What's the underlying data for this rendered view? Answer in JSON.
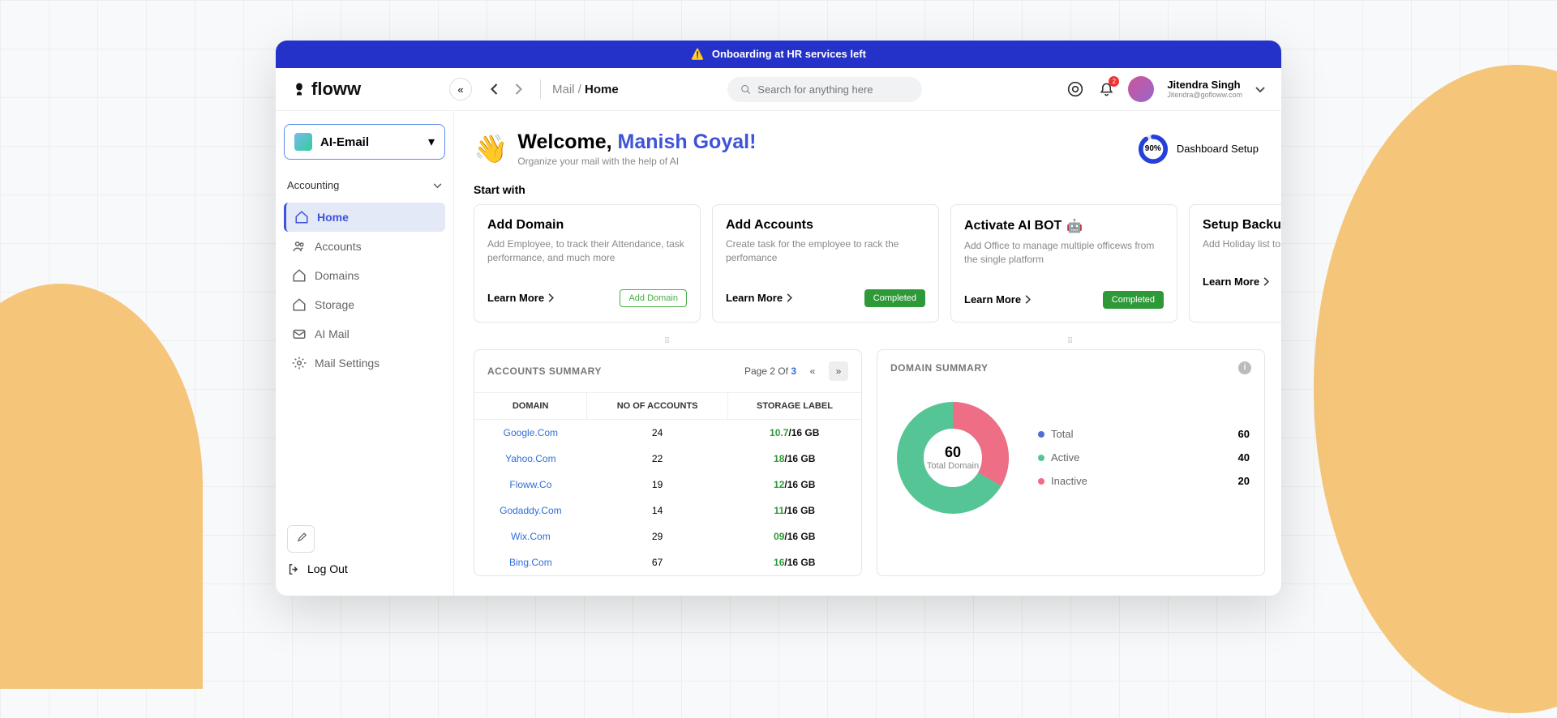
{
  "banner": {
    "text": "Onboarding at HR services left"
  },
  "brand": {
    "name": "floww"
  },
  "breadcrumb": {
    "section": "Mail",
    "current": "Home"
  },
  "search": {
    "placeholder": "Search for anything here"
  },
  "notifications": {
    "count": "2"
  },
  "user": {
    "name": "Jitendra Singh",
    "email": "Jitendra@gofloww.com"
  },
  "sidebar": {
    "app_selector": {
      "label": "AI-Email"
    },
    "section_label": "Accounting",
    "items": [
      {
        "icon": "home-icon",
        "label": "Home",
        "active": true
      },
      {
        "icon": "accounts-icon",
        "label": "Accounts"
      },
      {
        "icon": "domains-icon",
        "label": "Domains"
      },
      {
        "icon": "storage-icon",
        "label": "Storage"
      },
      {
        "icon": "aimail-icon",
        "label": "AI Mail"
      },
      {
        "icon": "settings-icon",
        "label": "Mail Settings"
      }
    ],
    "logout_label": "Log Out"
  },
  "welcome": {
    "greet": "Welcome, ",
    "name": "Manish Goyal!",
    "subtitle": "Organize your mail with the help of AI"
  },
  "setup": {
    "percent_label": "90%",
    "percent_value": 90,
    "text": "Dashboard Setup"
  },
  "start_with": "Start with",
  "cards": [
    {
      "title": "Add Domain",
      "desc": "Add Employee, to track their Attendance, task performance, and much more",
      "learn": "Learn More",
      "action": {
        "type": "button",
        "label": "Add  Domain"
      }
    },
    {
      "title": "Add Accounts",
      "desc": "Create task for the employee to rack the perfomance",
      "learn": "Learn More",
      "action": {
        "type": "status",
        "label": "Completed"
      }
    },
    {
      "title": "Activate AI BOT",
      "desc": "Add Office to manage multiple officews from the single platform",
      "learn": "Learn More",
      "robot": true,
      "action": {
        "type": "status",
        "label": "Completed"
      }
    },
    {
      "title": "Setup Backup",
      "desc": "Add Holiday list to m",
      "learn": "Learn More"
    }
  ],
  "accounts_panel": {
    "title": "ACCOUNTS SUMMARY",
    "pager": {
      "prefix": "Page 2 Of ",
      "total": "3"
    },
    "columns": [
      "DOMAIN",
      "NO OF ACCOUNTS",
      "STORAGE LABEL"
    ],
    "rows": [
      {
        "domain": "Google.Com",
        "accounts": "24",
        "used": "10.7",
        "total": "/16 GB"
      },
      {
        "domain": "Yahoo.Com",
        "accounts": "22",
        "used": "18",
        "total": "/16 GB"
      },
      {
        "domain": "Floww.Co",
        "accounts": "19",
        "used": "12",
        "total": "/16 GB"
      },
      {
        "domain": "Godaddy.Com",
        "accounts": "14",
        "used": "11",
        "total": "/16 GB"
      },
      {
        "domain": "Wix.Com",
        "accounts": "29",
        "used": "09",
        "total": "/16 GB"
      },
      {
        "domain": "Bing.Com",
        "accounts": "67",
        "used": "16",
        "total": "/16 GB"
      }
    ]
  },
  "domain_panel": {
    "title": "DOMAIN SUMMARY",
    "center": {
      "value": "60",
      "label": "Total Domain"
    },
    "legend": [
      {
        "label": "Total",
        "value": "60",
        "color": "#4f6ed4"
      },
      {
        "label": "Active",
        "value": "40",
        "color": "#56c596"
      },
      {
        "label": "Inactive",
        "value": "20",
        "color": "#ee6e85"
      }
    ]
  },
  "chart_data": {
    "type": "pie",
    "title": "Domain Summary",
    "series": [
      {
        "name": "Active",
        "value": 40,
        "color": "#56c596"
      },
      {
        "name": "Inactive",
        "value": 20,
        "color": "#ee6e85"
      }
    ],
    "total": 60
  }
}
